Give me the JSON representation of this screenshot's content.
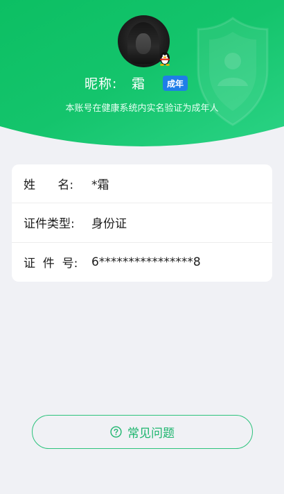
{
  "colors": {
    "header_green_light": "#2fd17f",
    "header_green_dark": "#0fbd66",
    "badge_blue": "#1f7ee8",
    "faq_green": "#1cb56d",
    "page_bg": "#f0f1f5"
  },
  "profile": {
    "nickname_label": "昵称:",
    "nickname": "霜",
    "adult_badge": "成年",
    "verify_note": "本账号在健康系统内实名验证为成年人",
    "avatar_icon": "user-avatar",
    "platform_icon": "qq-penguin-icon"
  },
  "info": {
    "rows": [
      {
        "label": "姓      名:",
        "value": "*霜"
      },
      {
        "label": "证件类型:",
        "value": "身份证"
      },
      {
        "label": "证  件  号:",
        "value": "6****************8"
      }
    ]
  },
  "faq": {
    "label": "常见问题",
    "icon": "question-circle-icon"
  }
}
